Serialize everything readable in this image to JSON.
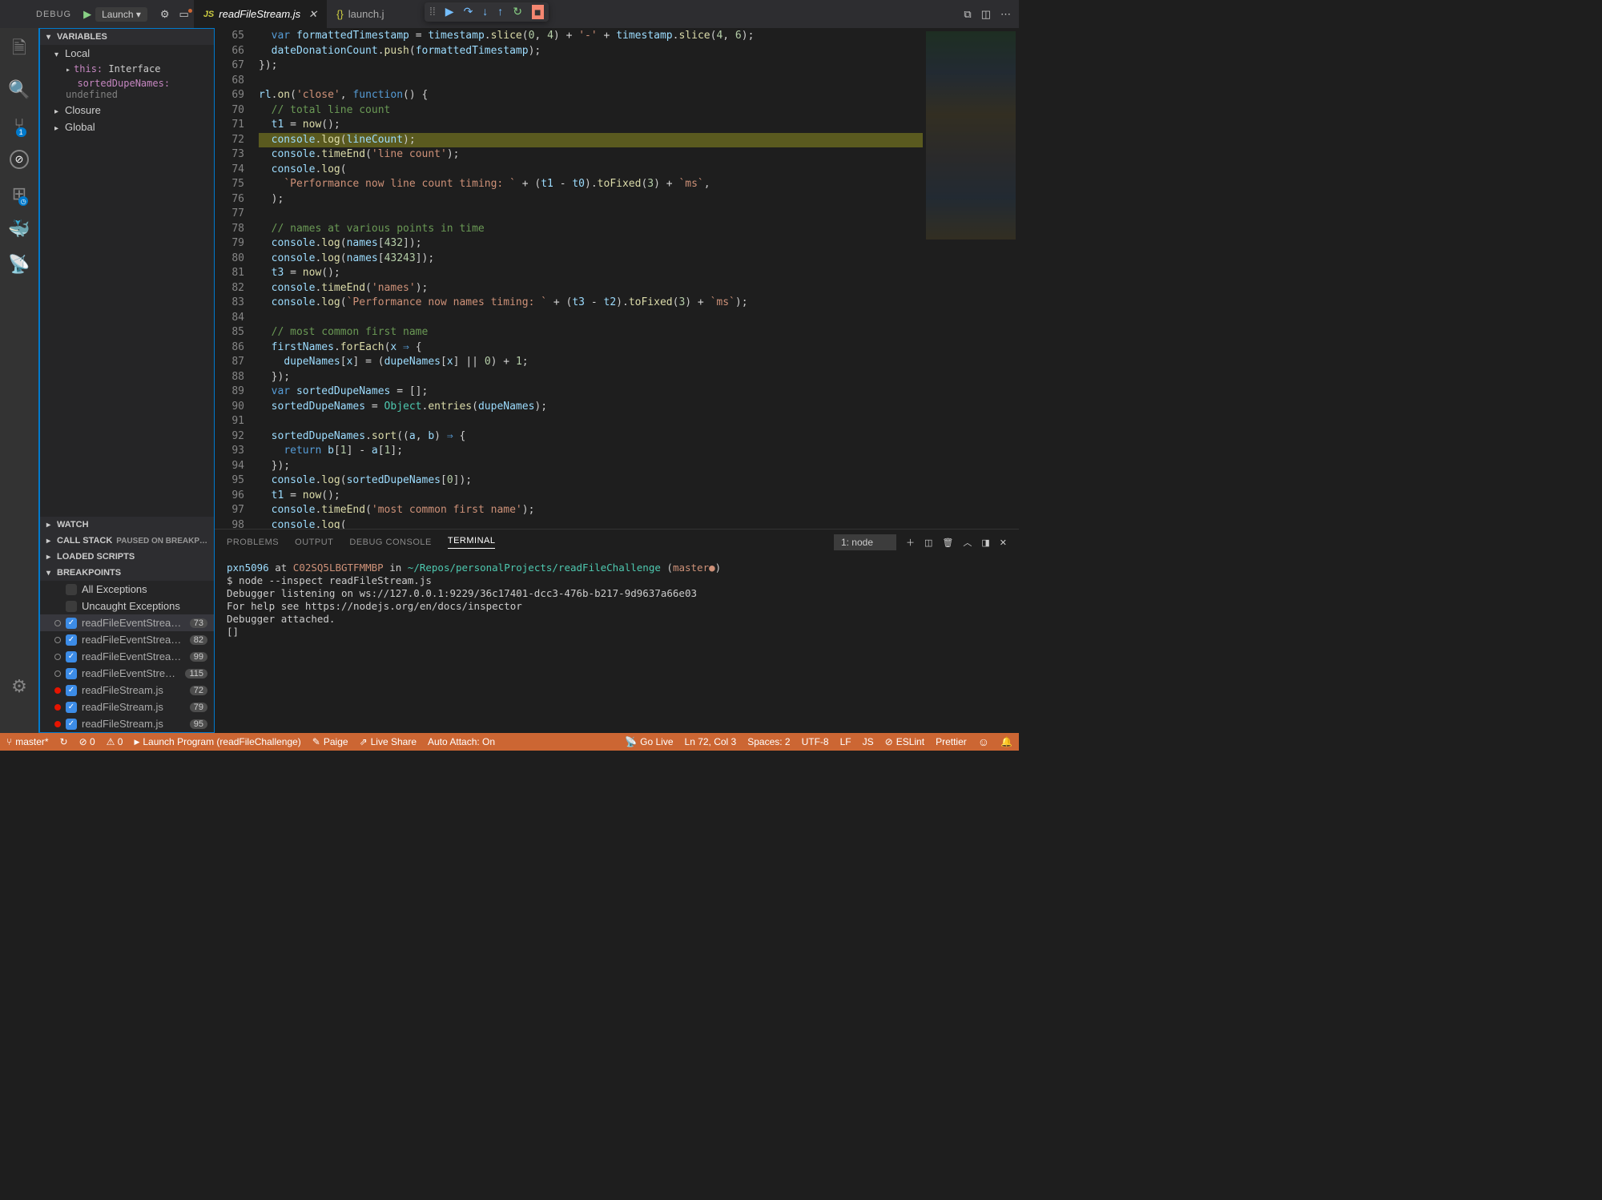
{
  "topbar": {
    "debug_label": "DEBUG",
    "launch_config": "Launch",
    "tabs": [
      {
        "icon": "JS",
        "name": "readFileStream.js",
        "active": true
      },
      {
        "icon": "{}",
        "name": "launch.j",
        "active": false
      }
    ]
  },
  "debug_controls": {
    "continue": "▶",
    "step_over": "↷",
    "step_into": "↓",
    "step_out": "↑",
    "restart": "↻",
    "stop": "■"
  },
  "sidebar": {
    "variables_header": "VARIABLES",
    "local_label": "Local",
    "this_key": "this:",
    "this_val": "Interface",
    "sorted_key": "sortedDupeNames:",
    "sorted_val": "undefined",
    "closure_label": "Closure",
    "global_label": "Global",
    "watch_header": "WATCH",
    "callstack_header": "CALL STACK",
    "callstack_status": "PAUSED ON BREAKP…",
    "loaded_header": "LOADED SCRIPTS",
    "breakpoints_header": "BREAKPOINTS",
    "all_exceptions": "All Exceptions",
    "uncaught": "Uncaught Exceptions",
    "bps": [
      {
        "file": "readFileEventStrea…",
        "line": "73",
        "active": true,
        "red": false
      },
      {
        "file": "readFileEventStrea…",
        "line": "82",
        "active": false,
        "red": false
      },
      {
        "file": "readFileEventStrea…",
        "line": "99",
        "active": false,
        "red": false
      },
      {
        "file": "readFileEventStre…",
        "line": "115",
        "active": false,
        "red": false
      },
      {
        "file": "readFileStream.js",
        "line": "72",
        "active": false,
        "red": true
      },
      {
        "file": "readFileStream.js",
        "line": "79",
        "active": false,
        "red": true
      },
      {
        "file": "readFileStream.js",
        "line": "95",
        "active": false,
        "red": true
      }
    ]
  },
  "editor": {
    "lines": [
      {
        "n": 65,
        "html": "  <span class='kw'>var</span> <span class='var'>formattedTimestamp</span> <span class='op'>=</span> <span class='var'>timestamp</span>.<span class='fn'>slice</span>(<span class='num'>0</span>, <span class='num'>4</span>) <span class='op'>+</span> <span class='str'>'-'</span> <span class='op'>+</span> <span class='var'>timestamp</span>.<span class='fn'>slice</span>(<span class='num'>4</span>, <span class='num'>6</span>);"
      },
      {
        "n": 66,
        "html": "  <span class='var'>dateDonationCount</span>.<span class='fn'>push</span>(<span class='var'>formattedTimestamp</span>);"
      },
      {
        "n": 67,
        "html": "});"
      },
      {
        "n": 68,
        "html": ""
      },
      {
        "n": 69,
        "html": "<span class='var'>rl</span>.<span class='fn'>on</span>(<span class='str'>'close'</span>, <span class='kw'>function</span>() {"
      },
      {
        "n": 70,
        "html": "  <span class='cmt'>// total line count</span>"
      },
      {
        "n": 71,
        "html": "  <span class='var'>t1</span> <span class='op'>=</span> <span class='fn'>now</span>();"
      },
      {
        "n": 72,
        "html": "  <span class='var'>console</span>.<span class='fn'>log</span>(<span class='var'>lineCount</span>);",
        "hl": true,
        "bp": "current"
      },
      {
        "n": 73,
        "html": "  <span class='var'>console</span>.<span class='fn'>timeEnd</span>(<span class='str'>'line count'</span>);"
      },
      {
        "n": 74,
        "html": "  <span class='var'>console</span>.<span class='fn'>log</span>("
      },
      {
        "n": 75,
        "html": "    <span class='str'>`Performance now line count timing: `</span> <span class='op'>+</span> (<span class='var'>t1</span> <span class='op'>-</span> <span class='var'>t0</span>).<span class='fn'>toFixed</span>(<span class='num'>3</span>) <span class='op'>+</span> <span class='str'>`ms`</span>,"
      },
      {
        "n": 76,
        "html": "  );"
      },
      {
        "n": 77,
        "html": ""
      },
      {
        "n": 78,
        "html": "  <span class='cmt'>// names at various points in time</span>"
      },
      {
        "n": 79,
        "html": "  <span class='var'>console</span>.<span class='fn'>log</span>(<span class='var'>names</span>[<span class='num'>432</span>]);",
        "bp": "red"
      },
      {
        "n": 80,
        "html": "  <span class='var'>console</span>.<span class='fn'>log</span>(<span class='var'>names</span>[<span class='num'>43243</span>]);"
      },
      {
        "n": 81,
        "html": "  <span class='var'>t3</span> <span class='op'>=</span> <span class='fn'>now</span>();"
      },
      {
        "n": 82,
        "html": "  <span class='var'>console</span>.<span class='fn'>timeEnd</span>(<span class='str'>'names'</span>);"
      },
      {
        "n": 83,
        "html": "  <span class='var'>console</span>.<span class='fn'>log</span>(<span class='str'>`Performance now names timing: `</span> <span class='op'>+</span> (<span class='var'>t3</span> <span class='op'>-</span> <span class='var'>t2</span>).<span class='fn'>toFixed</span>(<span class='num'>3</span>) <span class='op'>+</span> <span class='str'>`ms`</span>);"
      },
      {
        "n": 84,
        "html": ""
      },
      {
        "n": 85,
        "html": "  <span class='cmt'>// most common first name</span>"
      },
      {
        "n": 86,
        "html": "  <span class='var'>firstNames</span>.<span class='fn'>forEach</span>(<span class='var'>x</span> <span class='kw'>⇒</span> {"
      },
      {
        "n": 87,
        "html": "    <span class='var'>dupeNames</span>[<span class='var'>x</span>] <span class='op'>=</span> (<span class='var'>dupeNames</span>[<span class='var'>x</span>] <span class='op'>||</span> <span class='num'>0</span>) <span class='op'>+</span> <span class='num'>1</span>;"
      },
      {
        "n": 88,
        "html": "  });"
      },
      {
        "n": 89,
        "html": "  <span class='kw'>var</span> <span class='var'>sortedDupeNames</span> <span class='op'>=</span> [];"
      },
      {
        "n": 90,
        "html": "  <span class='var'>sortedDupeNames</span> <span class='op'>=</span> <span class='obj'>Object</span>.<span class='fn'>entries</span>(<span class='var'>dupeNames</span>);"
      },
      {
        "n": 91,
        "html": ""
      },
      {
        "n": 92,
        "html": "  <span class='var'>sortedDupeNames</span>.<span class='fn'>sort</span>((<span class='var'>a</span>, <span class='var'>b</span>) <span class='kw'>⇒</span> {"
      },
      {
        "n": 93,
        "html": "    <span class='kw'>return</span> <span class='var'>b</span>[<span class='num'>1</span>] <span class='op'>-</span> <span class='var'>a</span>[<span class='num'>1</span>];"
      },
      {
        "n": 94,
        "html": "  });"
      },
      {
        "n": 95,
        "html": "  <span class='var'>console</span>.<span class='fn'>log</span>(<span class='var'>sortedDupeNames</span>[<span class='num'>0</span>]);",
        "bp": "red"
      },
      {
        "n": 96,
        "html": "  <span class='var'>t1</span> <span class='op'>=</span> <span class='fn'>now</span>();"
      },
      {
        "n": 97,
        "html": "  <span class='var'>console</span>.<span class='fn'>timeEnd</span>(<span class='str'>'most common first name'</span>);"
      },
      {
        "n": 98,
        "html": "  <span class='var'>console</span>.<span class='fn'>log</span>("
      }
    ]
  },
  "panel": {
    "tabs": {
      "problems": "PROBLEMS",
      "output": "OUTPUT",
      "debug": "DEBUG CONSOLE",
      "terminal": "TERMINAL"
    },
    "term_select": "1: node",
    "terminal_lines": [
      "<span class='term-user'>pxn5096</span> at <span class='term-host'>C02SQ5LBGTFMMBP</span> in <span class='term-path'>~/Repos/personalProjects/readFileChallenge</span> (<span class='term-branch'>master●</span>)",
      "$ node --inspect readFileStream.js",
      "Debugger listening on ws://127.0.0.1:9229/36c17401-dcc3-476b-b217-9d9637a66e03",
      "For help see https://nodejs.org/en/docs/inspector",
      "Debugger attached.",
      "[]"
    ]
  },
  "statusbar": {
    "branch": "master*",
    "sync": "↻",
    "errors": "⊘ 0",
    "warnings": "⚠ 0",
    "launch": "Launch Program (readFileChallenge)",
    "paige": "Paige",
    "liveshare": "Live Share",
    "autoattach": "Auto Attach: On",
    "golive": "Go Live",
    "position": "Ln 72, Col 3",
    "spaces": "Spaces: 2",
    "encoding": "UTF-8",
    "eol": "LF",
    "lang": "JS",
    "eslint": "ESLint",
    "prettier": "Prettier"
  }
}
